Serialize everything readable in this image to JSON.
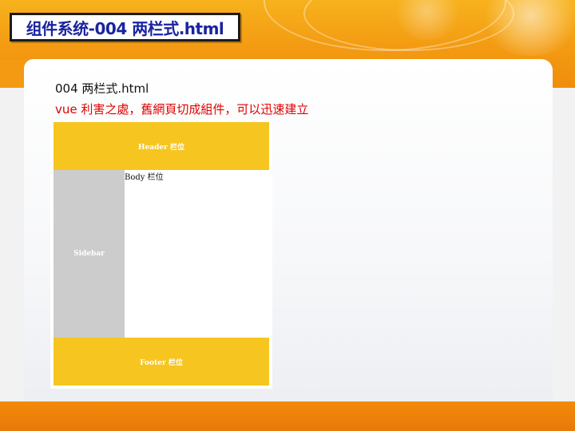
{
  "slide": {
    "title": "组件系统-004 两栏式.html",
    "filename_line": "004 两栏式.html",
    "description_line": "vue 利害之處，舊網頁切成組件，可以迅速建立"
  },
  "demo_layout": {
    "header_label": "Header 栏位",
    "sidebar_label": "Sidebar",
    "body_label": "Body 栏位",
    "footer_label": "Footer 栏位"
  },
  "colors": {
    "theme_orange": "#f39a12",
    "title_blue": "#1a23a0",
    "description_red": "#e00000",
    "panel_yellow": "#f6c51f",
    "sidebar_gray": "#cccccc"
  }
}
